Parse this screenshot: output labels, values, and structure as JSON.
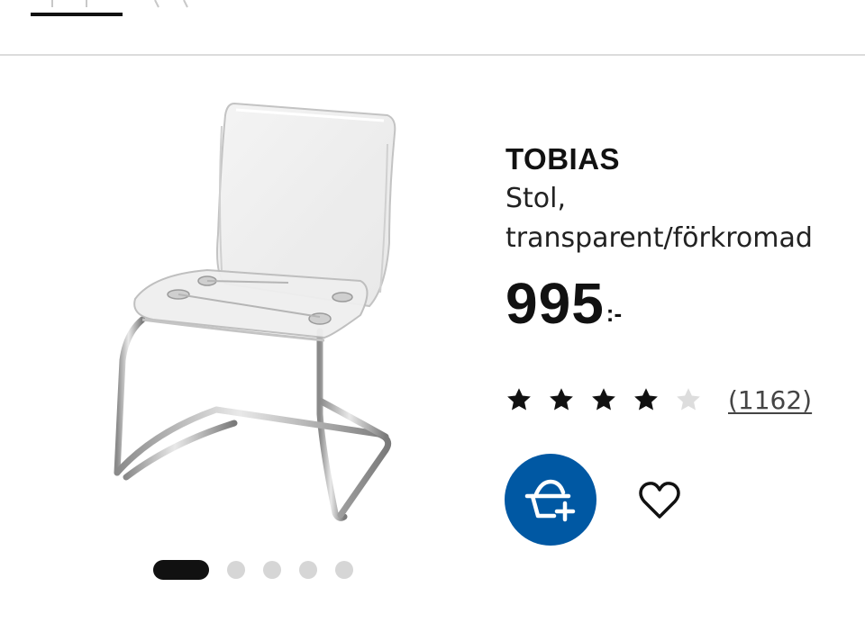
{
  "product": {
    "name": "TOBIAS",
    "description_line1": "Stol,",
    "description_line2": "transparent/förkromad",
    "price": "995",
    "price_suffix": ":-",
    "rating": {
      "value": 4,
      "max": 5
    },
    "review_count": "(1162)"
  },
  "gallery": {
    "image_icon": "transparent-chair-image",
    "dots": 5,
    "active_index": 0
  },
  "actions": {
    "add_to_cart_icon": "add-to-cart-basket-icon",
    "favorite_icon": "heart-icon"
  },
  "colors": {
    "primary": "#0058a3",
    "text": "#111111",
    "star_filled": "#111111",
    "star_empty": "#dddddd",
    "dot_inactive": "#d6d6d6"
  }
}
